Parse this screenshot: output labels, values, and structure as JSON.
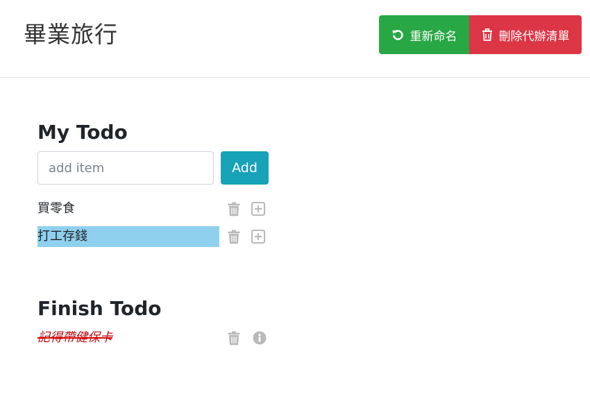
{
  "header": {
    "title": "畢業旅行",
    "rename_label": "重新命名",
    "delete_list_label": "刪除代辦清單"
  },
  "todo": {
    "heading": "My Todo",
    "input_placeholder": "add item",
    "input_value": "",
    "add_label": "Add",
    "items": [
      {
        "label": "買零食",
        "selected": false
      },
      {
        "label": "打工存錢",
        "selected": true
      }
    ]
  },
  "finished": {
    "heading": "Finish Todo",
    "items": [
      {
        "label": "記得帶健保卡"
      }
    ]
  },
  "colors": {
    "rename_button": "#28a745",
    "delete_button": "#dc3545",
    "add_button": "#17a2b8",
    "selection_highlight": "#90d0ef",
    "done_text": "#b5121b",
    "icon_gray": "#b9b9b9"
  },
  "icons": [
    "undo-icon",
    "trash-icon",
    "plus-square-icon",
    "info-circle-icon"
  ]
}
